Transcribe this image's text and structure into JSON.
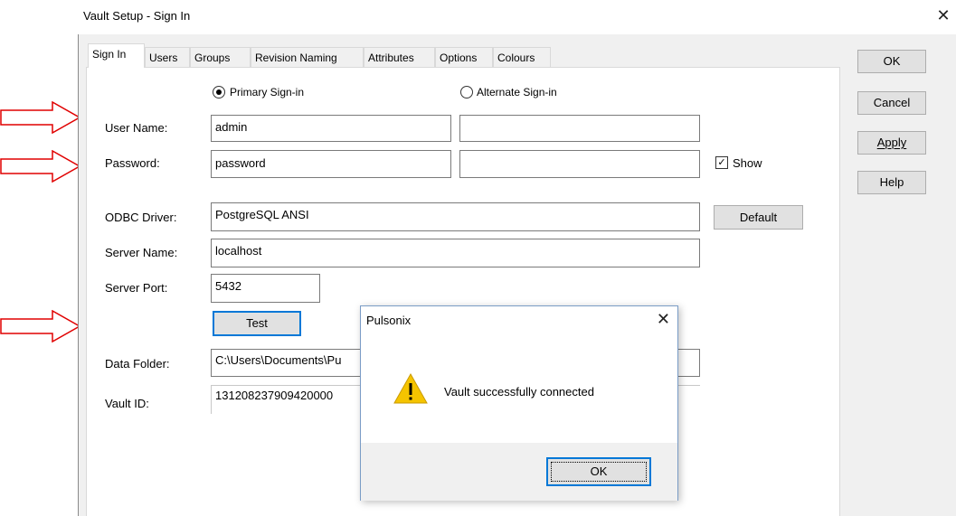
{
  "window": {
    "title": "Vault Setup - Sign In",
    "close": "✕"
  },
  "tabs": [
    "Sign In",
    "Users",
    "Groups",
    "Revision Naming",
    "Attributes",
    "Options",
    "Colours"
  ],
  "side_buttons": {
    "ok": "OK",
    "cancel": "Cancel",
    "apply": "Apply",
    "help": "Help"
  },
  "signin": {
    "primary_label": "Primary Sign-in",
    "alternate_label": "Alternate Sign-in",
    "primary_selected": true,
    "user_name_label": "User Name:",
    "user_name_primary": "admin",
    "user_name_alternate": "",
    "password_label": "Password:",
    "password_primary": "password",
    "password_alternate": "",
    "show_label": "Show",
    "show_checked": true,
    "odbc_label": "ODBC Driver:",
    "odbc_value": "PostgreSQL ANSI",
    "default_button": "Default",
    "server_name_label": "Server Name:",
    "server_name_value": "localhost",
    "server_port_label": "Server Port:",
    "server_port_value": "5432",
    "test_button": "Test",
    "data_folder_label": "Data Folder:",
    "data_folder_value": "C:\\Users\\Documents\\Pu",
    "vault_id_label": "Vault ID:",
    "vault_id_value": "131208237909420000"
  },
  "dialog": {
    "title": "Pulsonix",
    "close": "✕",
    "icon": "warning-icon",
    "message": "Vault successfully connected",
    "ok": "OK"
  },
  "colors": {
    "arrow": "#e00000",
    "focus": "#0078d7",
    "warning": "#f5c400"
  }
}
